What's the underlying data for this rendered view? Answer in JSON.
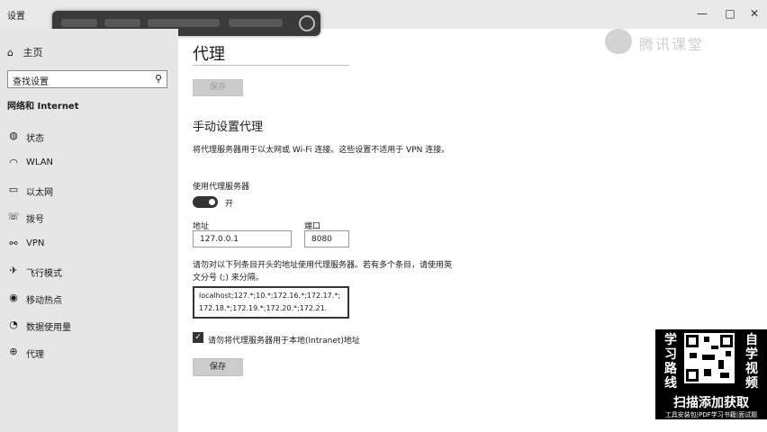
{
  "window": {
    "title": "设置",
    "minimize": "—",
    "maximize": "□",
    "close": "✕"
  },
  "sidebar": {
    "home_label": "主页",
    "search_placeholder": "查找设置",
    "section_title": "网络和 Internet",
    "items": [
      {
        "label": "状态",
        "icon": "globe-icon"
      },
      {
        "label": "WLAN",
        "icon": "wifi-icon"
      },
      {
        "label": "以太网",
        "icon": "ethernet-icon"
      },
      {
        "label": "拨号",
        "icon": "phone-icon"
      },
      {
        "label": "VPN",
        "icon": "vpn-icon"
      },
      {
        "label": "飞行模式",
        "icon": "airplane-icon"
      },
      {
        "label": "移动热点",
        "icon": "hotspot-icon"
      },
      {
        "label": "数据使用量",
        "icon": "pie-icon"
      },
      {
        "label": "代理",
        "icon": "globe-icon"
      }
    ]
  },
  "main": {
    "title": "代理",
    "top_button": "保存",
    "manual_title": "手动设置代理",
    "description": "将代理服务器用于以太网或 Wi-Fi 连接。这些设置不适用于 VPN 连接。",
    "use_proxy_label": "使用代理服务器",
    "toggle_state": "开",
    "address_label": "地址",
    "address_value": "127.0.0.1",
    "port_label": "端口",
    "port_value": "8080",
    "exceptions_label": "请勿对以下列条目开头的地址使用代理服务器。若有多个条目，请使用英文分号 (;) 来分隔。",
    "exceptions_value": "localhost;127.*;10.*;172.16.*;172.17.*;172.18.*;172.19.*;172.20.*;172.21.",
    "bypass_local_label": "请勿将代理服务器用于本地(Intranet)地址",
    "bypass_local_checked": true,
    "save_button": "保存"
  },
  "watermark": {
    "text": "腾讯课堂"
  },
  "promo": {
    "left": [
      "学",
      "习",
      "路",
      "线"
    ],
    "right": [
      "自",
      "学",
      "视",
      "频"
    ],
    "cta": "扫描添加获取",
    "sub": "工具安装包|PDF学习书籍|面试题"
  }
}
